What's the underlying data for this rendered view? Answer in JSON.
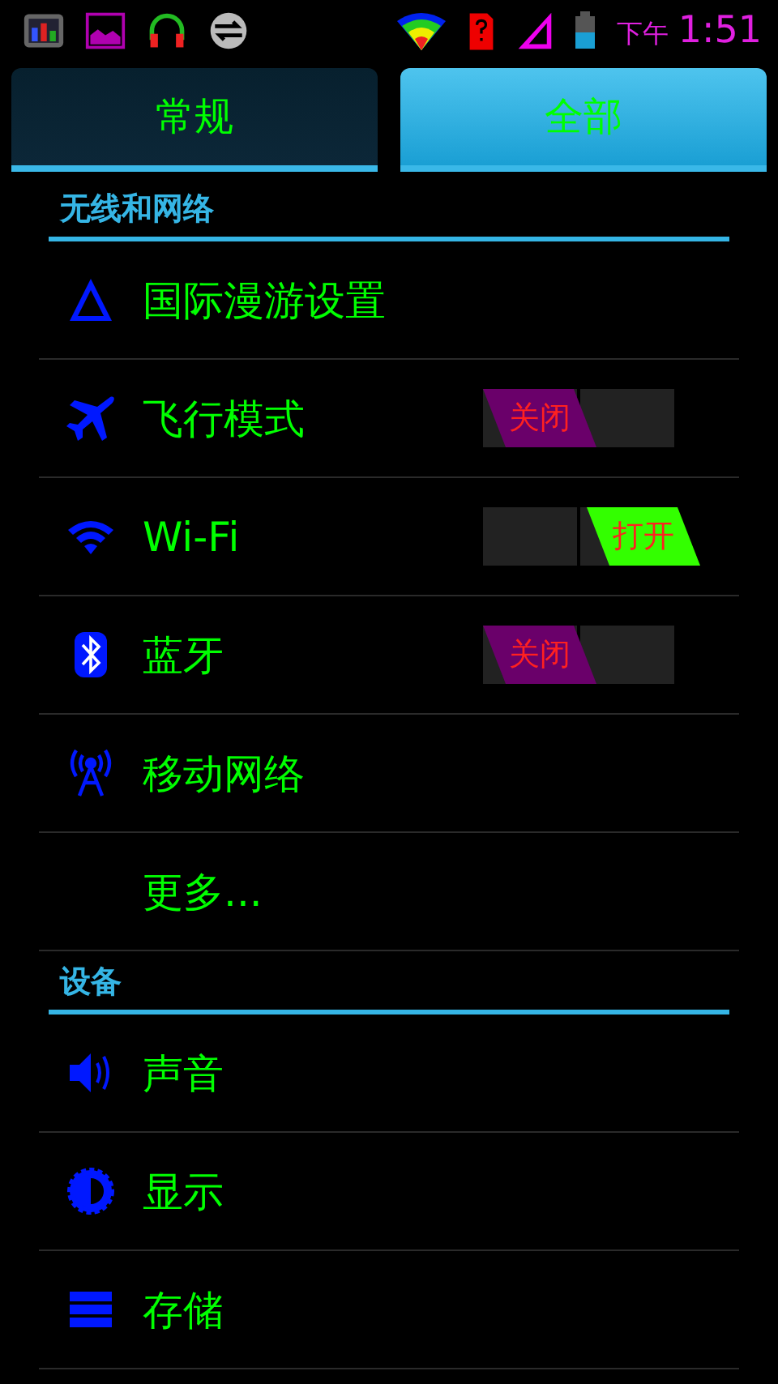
{
  "status_bar": {
    "period": "下午",
    "time": "1:51"
  },
  "tabs": [
    {
      "label": "常规",
      "selected": false
    },
    {
      "label": "全部",
      "selected": true
    }
  ],
  "sections": [
    {
      "title": "无线和网络",
      "items": [
        {
          "kind": "plain",
          "label": "国际漫游设置"
        },
        {
          "kind": "toggle",
          "label": "飞行模式",
          "on": false,
          "switch_text": "关闭"
        },
        {
          "kind": "toggle",
          "label": "Wi-Fi",
          "on": true,
          "switch_text": "打开"
        },
        {
          "kind": "toggle",
          "label": "蓝牙",
          "on": false,
          "switch_text": "关闭"
        },
        {
          "kind": "plain",
          "label": "移动网络"
        },
        {
          "kind": "plain",
          "label": "更多..."
        }
      ]
    },
    {
      "title": "设备",
      "items": [
        {
          "kind": "plain",
          "label": "声音"
        },
        {
          "kind": "plain",
          "label": "显示"
        },
        {
          "kind": "plain",
          "label": "存储"
        }
      ]
    }
  ]
}
